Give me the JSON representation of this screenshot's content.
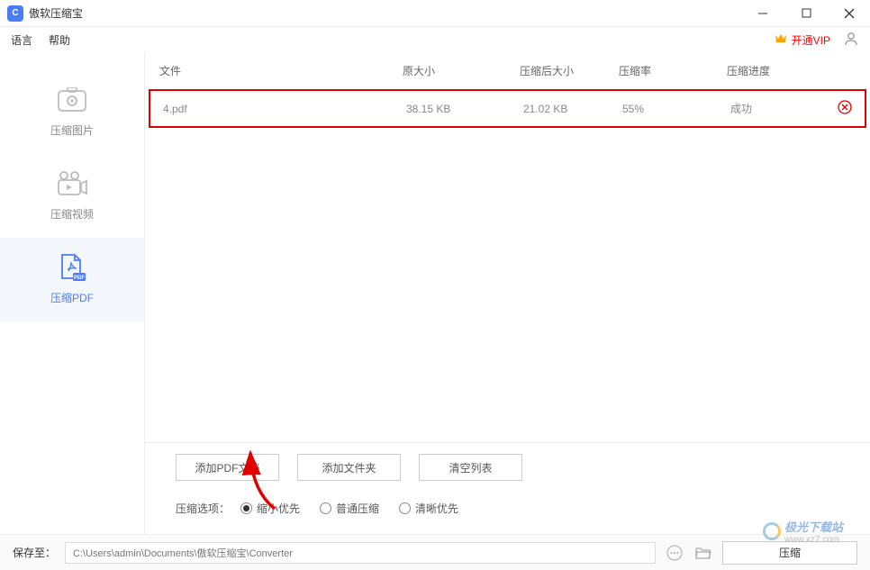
{
  "app": {
    "title": "傲软压缩宝",
    "icon_letter": "C"
  },
  "menu": {
    "language": "语言",
    "help": "帮助",
    "vip": "开通VIP"
  },
  "sidebar": {
    "items": [
      {
        "label": "压缩图片"
      },
      {
        "label": "压缩视频"
      },
      {
        "label": "压缩PDF"
      }
    ]
  },
  "table": {
    "headers": {
      "file": "文件",
      "original_size": "原大小",
      "compressed_size": "压缩后大小",
      "ratio": "压缩率",
      "progress": "压缩进度"
    },
    "rows": [
      {
        "file": "4.pdf",
        "original_size": "38.15 KB",
        "compressed_size": "21.02 KB",
        "ratio": "55%",
        "progress": "成功"
      }
    ]
  },
  "buttons": {
    "add_pdf": "添加PDF文档",
    "add_folder": "添加文件夹",
    "clear_list": "清空列表"
  },
  "options": {
    "label": "压缩选项：",
    "items": [
      {
        "label": "缩小优先",
        "checked": true
      },
      {
        "label": "普通压缩",
        "checked": false
      },
      {
        "label": "清晰优先",
        "checked": false
      }
    ]
  },
  "footer": {
    "save_to": "保存至：",
    "path": "C:\\Users\\admin\\Documents\\傲软压缩宝\\Converter",
    "compress": "压缩"
  },
  "watermark": {
    "text": "极光下载站",
    "url": "www.xz7.com"
  }
}
